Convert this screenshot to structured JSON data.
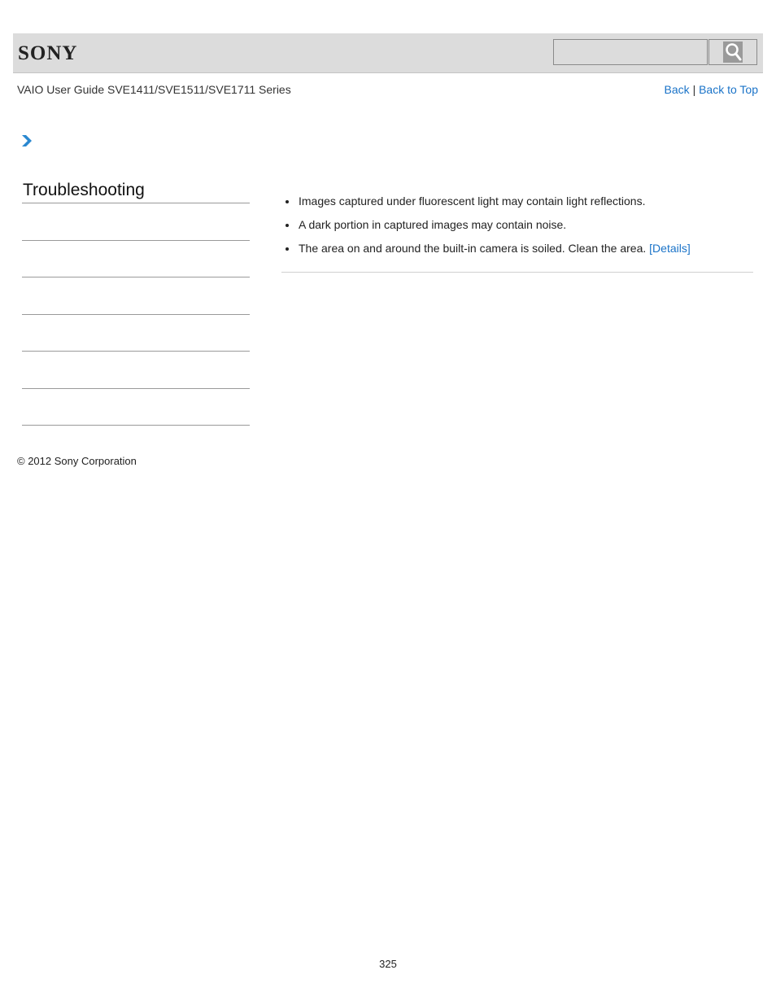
{
  "header": {
    "logo_text": "SONY",
    "search": {
      "placeholder": "",
      "value": ""
    },
    "search_button_icon": "search-icon"
  },
  "subtitle": "VAIO User Guide SVE1411/SVE1511/SVE1711 Series",
  "nav": {
    "back_label": "Back",
    "separator": "|",
    "back_to_top_label": "Back to Top"
  },
  "breadcrumb_icon": "chevron-right-icon",
  "sidebar": {
    "title": "Troubleshooting",
    "items": [
      "",
      "",
      "",
      "",
      "",
      ""
    ]
  },
  "content": {
    "items": [
      {
        "text": "Images captured under fluorescent light may contain light reflections.",
        "link": ""
      },
      {
        "text": "A dark portion in captured images may contain noise.",
        "link": ""
      },
      {
        "text": "The area on and around the built-in camera is soiled. Clean the area. ",
        "link": "[Details]"
      }
    ]
  },
  "footer": {
    "copyright": "© 2012 Sony Corporation",
    "page_number": "325"
  },
  "colors": {
    "link": "#1a73c8",
    "header_bg": "#dcdcdc",
    "chevron": "#2a88d0"
  }
}
